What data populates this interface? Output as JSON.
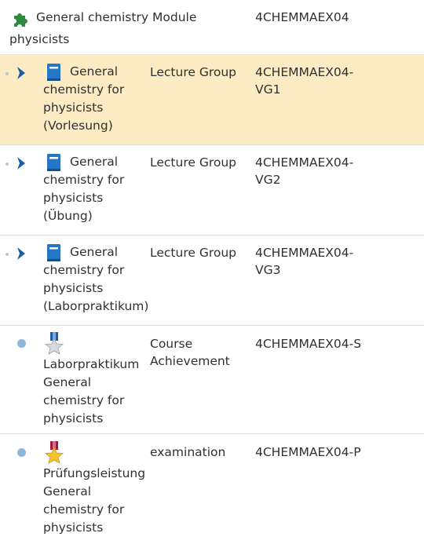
{
  "module": {
    "title": "General chemistry for physicists",
    "type": "Module",
    "code": "4CHEMMAEX04",
    "icon": "puzzle-icon",
    "icon_color": "#2e8b3e"
  },
  "rows": [
    {
      "icon": "book-icon",
      "marker": "chevron-right-icon",
      "title_first": "General",
      "title_rest": "chemistry for physicists (Vorlesung)",
      "type": "Lecture Group",
      "code_line1": "4CHEMMAEX04-",
      "code_line2": "VG1",
      "selected": true
    },
    {
      "icon": "book-icon",
      "marker": "chevron-right-icon",
      "title_first": "General",
      "title_rest": "chemistry for physicists (Übung)",
      "type": "Lecture Group",
      "code_line1": "4CHEMMAEX04-",
      "code_line2": "VG2",
      "selected": false
    },
    {
      "icon": "book-icon",
      "marker": "chevron-right-icon",
      "title_first": "General",
      "title_rest": "chemistry for physicists (Laborpraktikum)",
      "type": "Lecture Group",
      "code_line1": "4CHEMMAEX04-",
      "code_line2": "VG3",
      "selected": false
    },
    {
      "icon": "silver-medal-icon",
      "marker": "bullet-dot",
      "title": "Laborpraktikum General chemistry for physicists",
      "type_line1": "Course",
      "type_line2": "Achievement",
      "code_line1": "4CHEMMAEX04-S",
      "selected": false
    },
    {
      "icon": "gold-medal-icon",
      "marker": "bullet-dot",
      "title": "Prüfungsleistung General chemistry for physicists",
      "type_line1": "examination",
      "code_line1": "4CHEMMAEX04-P",
      "selected": false
    }
  ],
  "colors": {
    "selected_row": "#fcebc3",
    "chevron": "#1b5fa8",
    "book": "#2576c7",
    "bullet": "#8fb7dc"
  }
}
